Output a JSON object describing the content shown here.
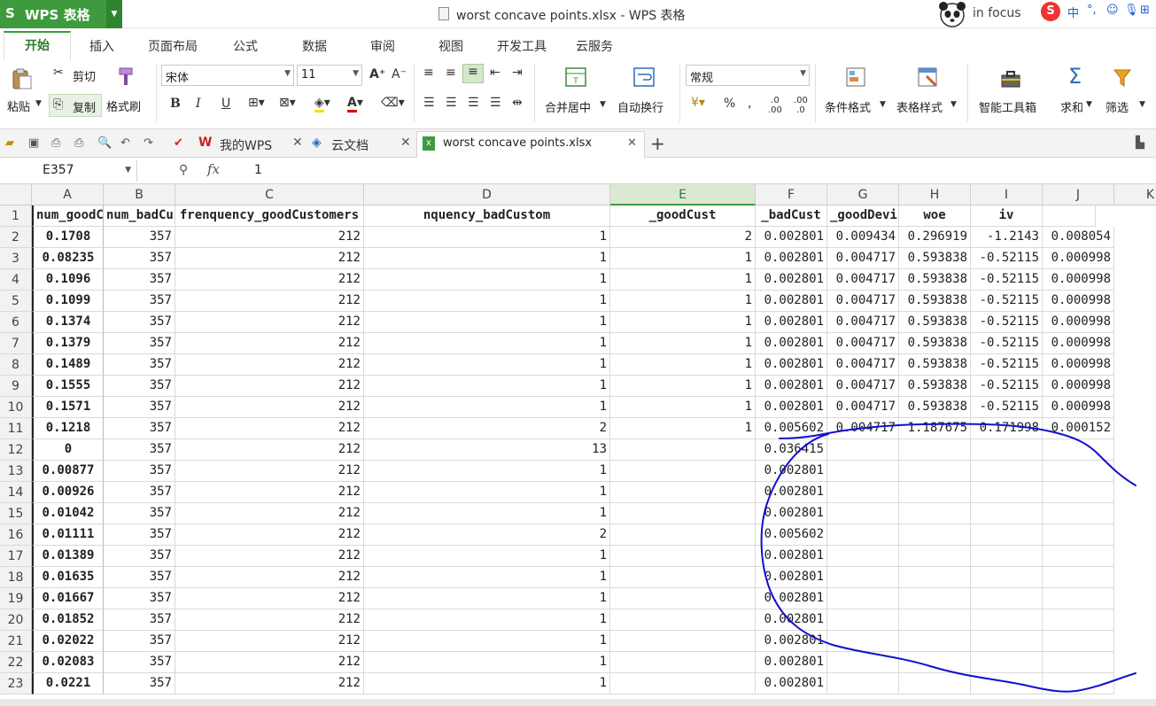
{
  "app": {
    "name": "WPS 表格",
    "logo": "S"
  },
  "window": {
    "title": "worst concave points.xlsx - WPS 表格"
  },
  "user": {
    "name": "in focus"
  },
  "ime": {
    "items": [
      "中",
      "°,",
      "☺",
      "🎙",
      "⊞",
      "⋮"
    ]
  },
  "menu": {
    "tabs": [
      "开始",
      "插入",
      "页面布局",
      "公式",
      "数据",
      "审阅",
      "视图",
      "开发工具",
      "云服务"
    ]
  },
  "ribbon": {
    "paste": "粘贴",
    "cut": "剪切",
    "copy": "复制",
    "format_painter": "格式刷",
    "font_name": "宋体",
    "font_size": "11",
    "merge_center": "合并居中",
    "wrap_text": "自动换行",
    "number_format": "常规",
    "conditional_format": "条件格式",
    "table_style": "表格样式",
    "smart_toolbox": "智能工具箱",
    "sum": "求和",
    "filter": "筛选"
  },
  "tabs_bar": {
    "my_wps": "我的WPS",
    "cloud_docs": "云文档",
    "active_file": "worst concave points.xlsx"
  },
  "formula_bar": {
    "name_box": "E357",
    "fx": "fx",
    "value": "1"
  },
  "sheet": {
    "columns": [
      "A",
      "B",
      "C",
      "D",
      "E",
      "F",
      "G",
      "H",
      "I",
      "J",
      "K"
    ],
    "selected_column": "E",
    "headers": [
      "num_goodCusto",
      "num_badCustomers",
      "frenquency_goodCustomers",
      "nquency_badCustom",
      "_goodCust",
      "_badCust",
      "_goodDevi",
      "woe",
      "iv"
    ],
    "rows": [
      [
        "2",
        "0.1708",
        "357",
        "212",
        "1",
        "2",
        "0.002801",
        "0.009434",
        "0.296919",
        "-1.2143",
        "0.008054"
      ],
      [
        "3",
        "0.08235",
        "357",
        "212",
        "1",
        "1",
        "0.002801",
        "0.004717",
        "0.593838",
        "-0.52115",
        "0.000998"
      ],
      [
        "4",
        "0.1096",
        "357",
        "212",
        "1",
        "1",
        "0.002801",
        "0.004717",
        "0.593838",
        "-0.52115",
        "0.000998"
      ],
      [
        "5",
        "0.1099",
        "357",
        "212",
        "1",
        "1",
        "0.002801",
        "0.004717",
        "0.593838",
        "-0.52115",
        "0.000998"
      ],
      [
        "6",
        "0.1374",
        "357",
        "212",
        "1",
        "1",
        "0.002801",
        "0.004717",
        "0.593838",
        "-0.52115",
        "0.000998"
      ],
      [
        "7",
        "0.1379",
        "357",
        "212",
        "1",
        "1",
        "0.002801",
        "0.004717",
        "0.593838",
        "-0.52115",
        "0.000998"
      ],
      [
        "8",
        "0.1489",
        "357",
        "212",
        "1",
        "1",
        "0.002801",
        "0.004717",
        "0.593838",
        "-0.52115",
        "0.000998"
      ],
      [
        "9",
        "0.1555",
        "357",
        "212",
        "1",
        "1",
        "0.002801",
        "0.004717",
        "0.593838",
        "-0.52115",
        "0.000998"
      ],
      [
        "10",
        "0.1571",
        "357",
        "212",
        "1",
        "1",
        "0.002801",
        "0.004717",
        "0.593838",
        "-0.52115",
        "0.000998"
      ],
      [
        "11",
        "0.1218",
        "357",
        "212",
        "2",
        "1",
        "0.005602",
        "0.004717",
        "1.187675",
        "0.171998",
        "0.000152"
      ],
      [
        "12",
        "0",
        "357",
        "212",
        "13",
        "",
        "0.036415",
        "",
        "",
        "",
        ""
      ],
      [
        "13",
        "0.00877",
        "357",
        "212",
        "1",
        "",
        "0.002801",
        "",
        "",
        "",
        ""
      ],
      [
        "14",
        "0.00926",
        "357",
        "212",
        "1",
        "",
        "0.002801",
        "",
        "",
        "",
        ""
      ],
      [
        "15",
        "0.01042",
        "357",
        "212",
        "1",
        "",
        "0.002801",
        "",
        "",
        "",
        ""
      ],
      [
        "16",
        "0.01111",
        "357",
        "212",
        "2",
        "",
        "0.005602",
        "",
        "",
        "",
        ""
      ],
      [
        "17",
        "0.01389",
        "357",
        "212",
        "1",
        "",
        "0.002801",
        "",
        "",
        "",
        ""
      ],
      [
        "18",
        "0.01635",
        "357",
        "212",
        "1",
        "",
        "0.002801",
        "",
        "",
        "",
        ""
      ],
      [
        "19",
        "0.01667",
        "357",
        "212",
        "1",
        "",
        "0.002801",
        "",
        "",
        "",
        ""
      ],
      [
        "20",
        "0.01852",
        "357",
        "212",
        "1",
        "",
        "0.002801",
        "",
        "",
        "",
        ""
      ],
      [
        "21",
        "0.02022",
        "357",
        "212",
        "1",
        "",
        "0.002801",
        "",
        "",
        "",
        ""
      ],
      [
        "22",
        "0.02083",
        "357",
        "212",
        "1",
        "",
        "0.002801",
        "",
        "",
        "",
        ""
      ],
      [
        "23",
        "0.0221",
        "357",
        "212",
        "1",
        "",
        "0.002801",
        "",
        "",
        "",
        ""
      ]
    ]
  },
  "colors": {
    "accent": "#3d9b3d",
    "annotation_ink": "#1010d0"
  }
}
